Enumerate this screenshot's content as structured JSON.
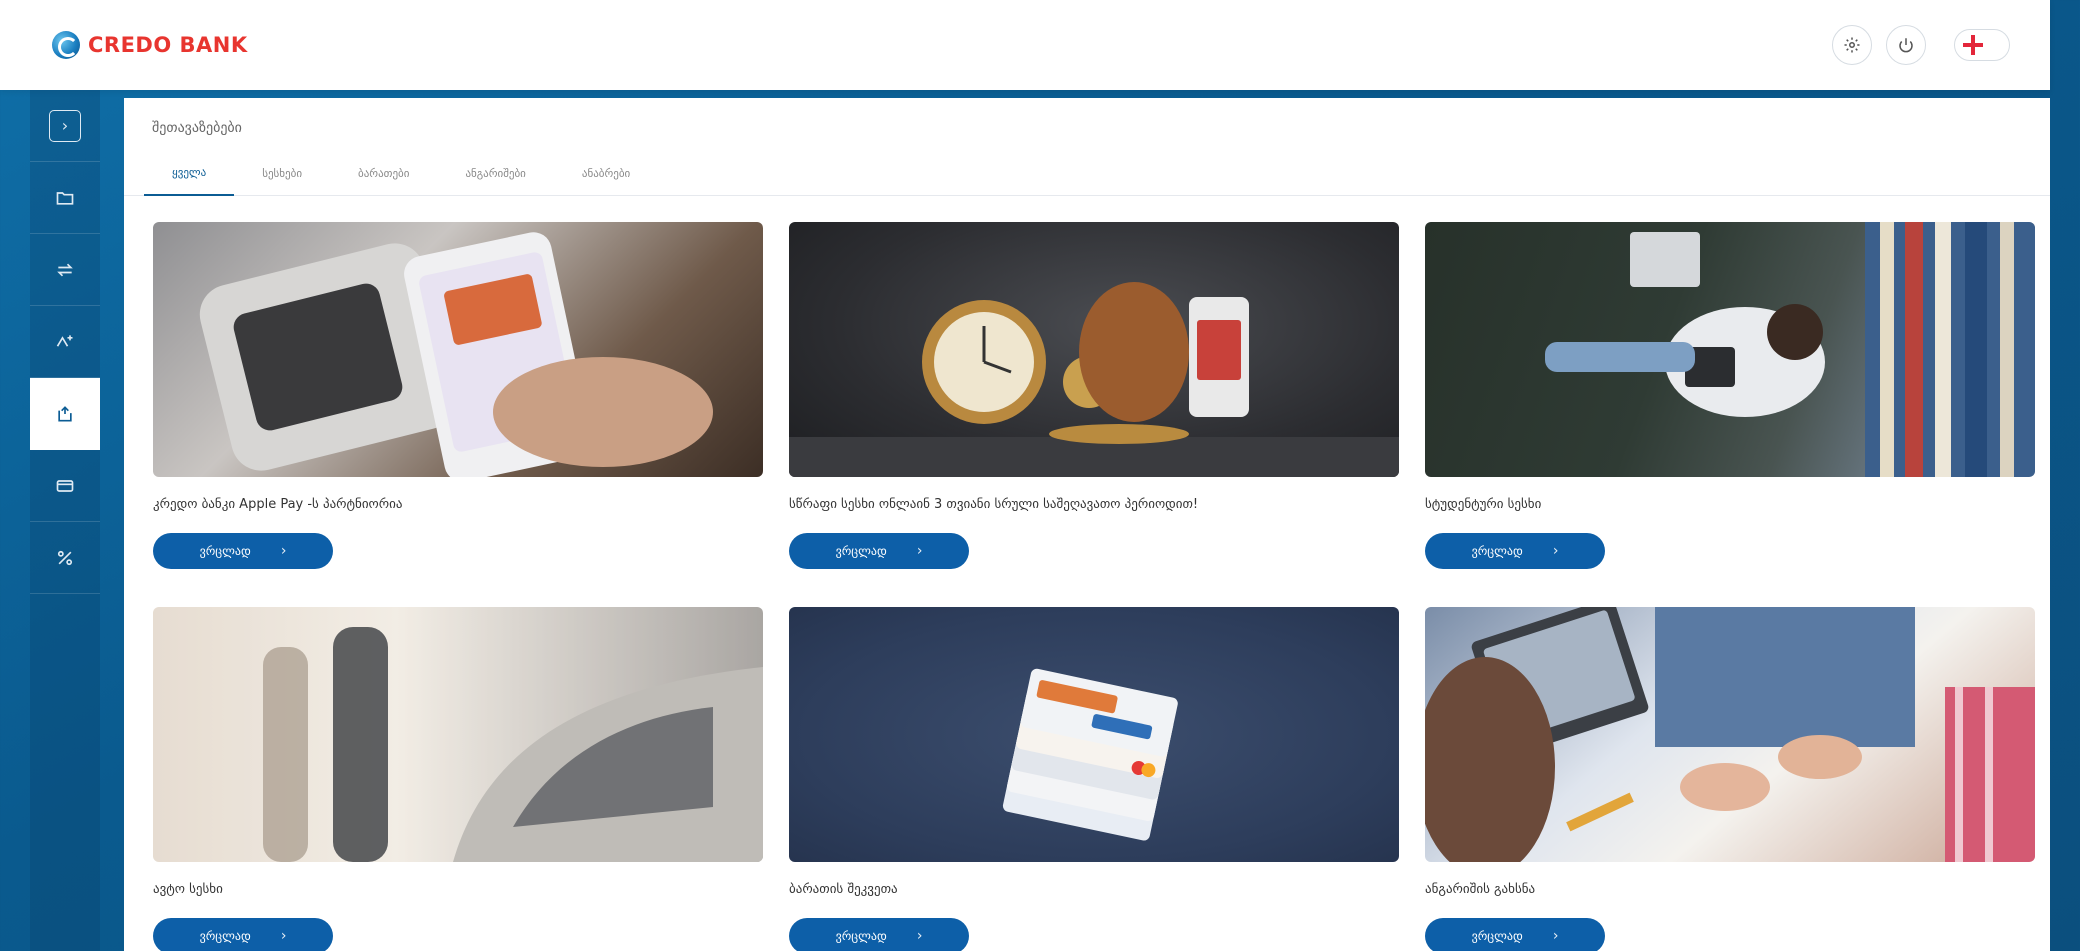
{
  "header": {
    "brand_name": "CREDO BANK",
    "actions": [
      {
        "icon": "gear-icon"
      },
      {
        "icon": "power-icon"
      }
    ],
    "language_flag": "georgia-flag-icon"
  },
  "sidebar": {
    "items": [
      {
        "icon": "expand-chevron-icon"
      },
      {
        "icon": "folder-icon"
      },
      {
        "icon": "transfer-arrows-icon"
      },
      {
        "icon": "shuffle-icon"
      },
      {
        "icon": "offers-icon",
        "active": true
      },
      {
        "icon": "card-icon"
      },
      {
        "icon": "percent-icon"
      }
    ]
  },
  "main": {
    "page_title": "შეთავაზებები",
    "tabs": [
      {
        "label": "ყველა",
        "active": true
      },
      {
        "label": "სესხები"
      },
      {
        "label": "ბარათები"
      },
      {
        "label": "ანგარიშები"
      },
      {
        "label": "ანაბრები"
      }
    ],
    "cards": [
      {
        "title": "კრედო ბანკი Apple Pay -ს პარტნიორია",
        "button": "ვრცლად",
        "image": "apple-pay-terminal"
      },
      {
        "title": "სწრაფი სესხი ონლაინ 3 თვიანი სრული საშეღავათო პერიოდით!",
        "button": "ვრცლად",
        "image": "clock-money-bag"
      },
      {
        "title": "სტუდენტური სესხი",
        "button": "ვრცლად",
        "image": "student-library"
      },
      {
        "title": "ავტო სესხი",
        "button": "ვრცლად",
        "image": "car-showroom"
      },
      {
        "title": "ბარათის შეკვეთა",
        "button": "ვრცლად",
        "image": "card-stack"
      },
      {
        "title": "ანგარიშის გახსნა",
        "button": "ვრცლად",
        "image": "office-meeting"
      }
    ]
  },
  "colors": {
    "brand_red": "#e8352f",
    "primary_blue": "#0d5fa8",
    "background_blue": "#0a5a8e"
  }
}
